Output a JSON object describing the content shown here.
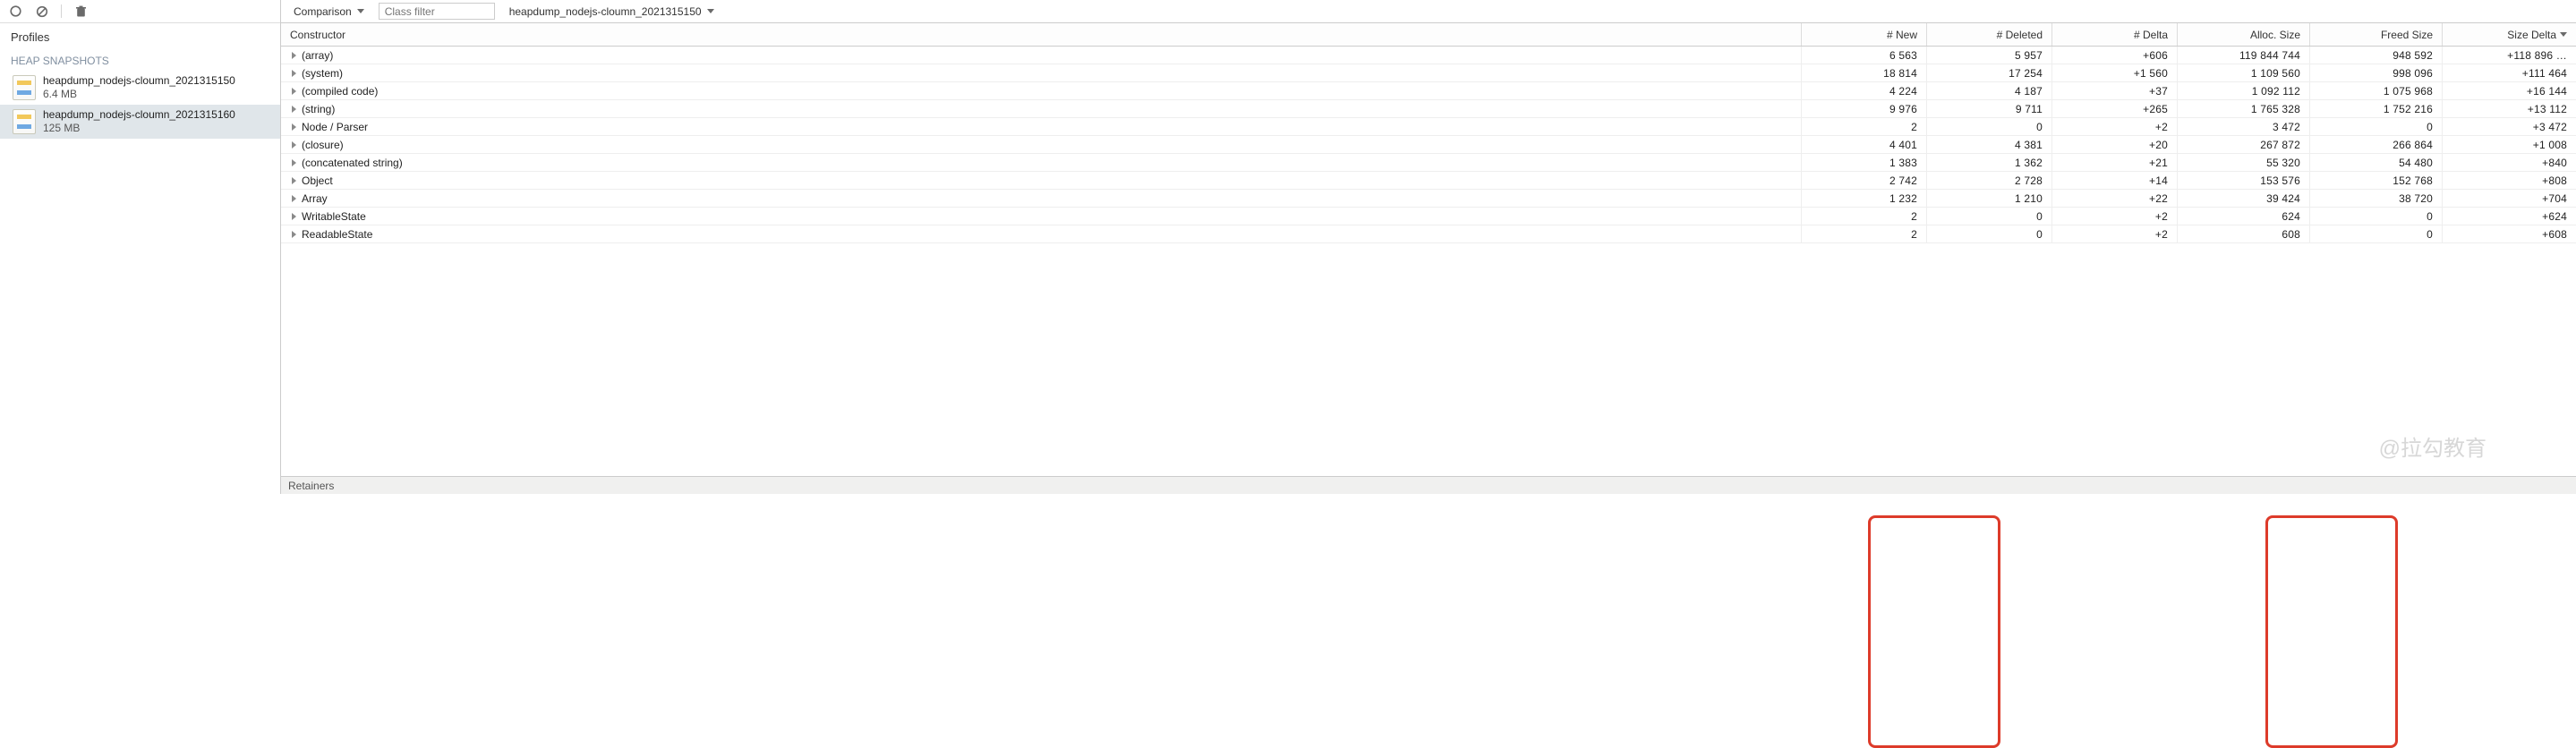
{
  "sidebar": {
    "heading": "Profiles",
    "subheading": "HEAP SNAPSHOTS",
    "snapshots": [
      {
        "name": "heapdump_nodejs-cloumn_2021315150",
        "size": "6.4 MB"
      },
      {
        "name": "heapdump_nodejs-cloumn_2021315160",
        "size": "125 MB"
      }
    ],
    "selected_index": 1
  },
  "toolbar": {
    "mode_label": "Comparison",
    "class_filter_placeholder": "Class filter",
    "baseline_label": "heapdump_nodejs-cloumn_2021315150"
  },
  "table": {
    "columns": {
      "constructor": "Constructor",
      "new": "# New",
      "deleted": "# Deleted",
      "delta": "# Delta",
      "alloc_size": "Alloc. Size",
      "freed_size": "Freed Size",
      "size_delta": "Size Delta"
    },
    "sort_column": "size_delta",
    "rows": [
      {
        "constructor": "(array)",
        "new": "6 563",
        "deleted": "5 957",
        "delta": "+606",
        "alloc": "119 844 744",
        "freed": "948 592",
        "size_delta": "+118 896 …"
      },
      {
        "constructor": "(system)",
        "new": "18 814",
        "deleted": "17 254",
        "delta": "+1 560",
        "alloc": "1 109 560",
        "freed": "998 096",
        "size_delta": "+111 464"
      },
      {
        "constructor": "(compiled code)",
        "new": "4 224",
        "deleted": "4 187",
        "delta": "+37",
        "alloc": "1 092 112",
        "freed": "1 075 968",
        "size_delta": "+16 144"
      },
      {
        "constructor": "(string)",
        "new": "9 976",
        "deleted": "9 711",
        "delta": "+265",
        "alloc": "1 765 328",
        "freed": "1 752 216",
        "size_delta": "+13 112"
      },
      {
        "constructor": "Node / Parser",
        "new": "2",
        "deleted": "0",
        "delta": "+2",
        "alloc": "3 472",
        "freed": "0",
        "size_delta": "+3 472"
      },
      {
        "constructor": "(closure)",
        "new": "4 401",
        "deleted": "4 381",
        "delta": "+20",
        "alloc": "267 872",
        "freed": "266 864",
        "size_delta": "+1 008"
      },
      {
        "constructor": "(concatenated string)",
        "new": "1 383",
        "deleted": "1 362",
        "delta": "+21",
        "alloc": "55 320",
        "freed": "54 480",
        "size_delta": "+840"
      },
      {
        "constructor": "Object",
        "new": "2 742",
        "deleted": "2 728",
        "delta": "+14",
        "alloc": "153 576",
        "freed": "152 768",
        "size_delta": "+808"
      },
      {
        "constructor": "Array",
        "new": "1 232",
        "deleted": "1 210",
        "delta": "+22",
        "alloc": "39 424",
        "freed": "38 720",
        "size_delta": "+704"
      },
      {
        "constructor": "WritableState",
        "new": "2",
        "deleted": "0",
        "delta": "+2",
        "alloc": "624",
        "freed": "0",
        "size_delta": "+624"
      },
      {
        "constructor": "ReadableState",
        "new": "2",
        "deleted": "0",
        "delta": "+2",
        "alloc": "608",
        "freed": "0",
        "size_delta": "+608"
      }
    ]
  },
  "retainers_label": "Retainers",
  "watermark": "@拉勾教育"
}
